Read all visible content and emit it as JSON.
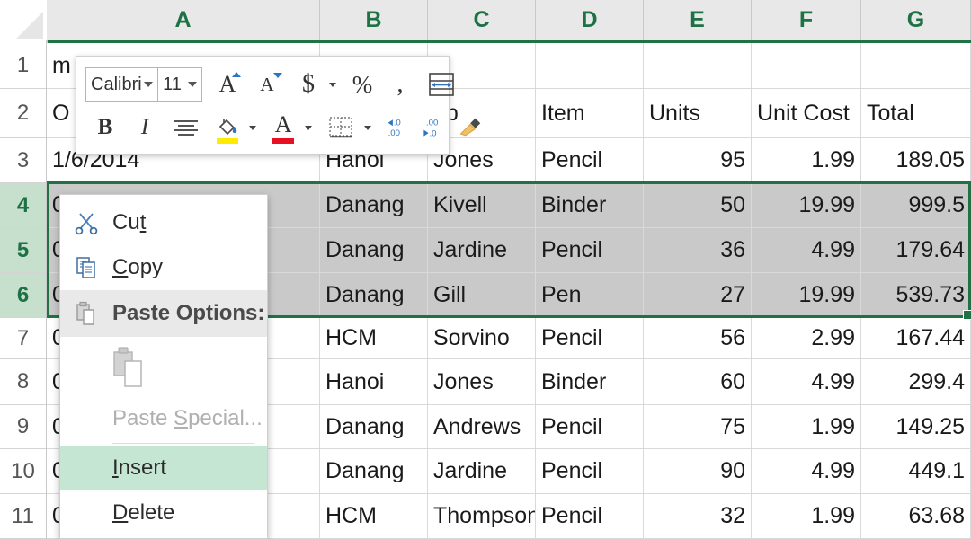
{
  "app": {
    "name": "excel-spreadsheet",
    "accent_green": "#207245",
    "header_text_green": "#1e7145",
    "selection_row_header_bg": "#c6e0cd",
    "selected_cell_bg": "#c9c9c9",
    "menu_highlight_bg": "#c6e6d4"
  },
  "grid": {
    "column_headers": [
      "A",
      "B",
      "C",
      "D",
      "E",
      "F",
      "G"
    ],
    "row_headers": [
      "1",
      "2",
      "3",
      "4",
      "5",
      "6",
      "7",
      "8",
      "9",
      "10",
      "11"
    ],
    "selected_rows": [
      "4",
      "5",
      "6"
    ]
  },
  "sheet": {
    "header_row_index": 2,
    "headers": {
      "A": "",
      "B": "",
      "C": "ep",
      "D": "Item",
      "E": "Units",
      "F": "Unit Cost",
      "G": "Total"
    },
    "partial_cells": {
      "A1": "m",
      "A2": "O"
    },
    "rows": [
      {
        "row": "3",
        "A": "1/6/2014",
        "B": "Hanoi",
        "C": "Jones",
        "D": "Pencil",
        "E": "95",
        "F": "1.99",
        "G": "189.05",
        "selected": false
      },
      {
        "row": "4",
        "A": "014",
        "B": "Danang",
        "C": "Kivell",
        "D": "Binder",
        "E": "50",
        "F": "19.99",
        "G": "999.5",
        "selected": true
      },
      {
        "row": "5",
        "A": "014",
        "B": "Danang",
        "C": "Jardine",
        "D": "Pencil",
        "E": "36",
        "F": "4.99",
        "G": "179.64",
        "selected": true
      },
      {
        "row": "6",
        "A": "014",
        "B": "Danang",
        "C": "Gill",
        "D": "Pen",
        "E": "27",
        "F": "19.99",
        "G": "539.73",
        "selected": true
      },
      {
        "row": "7",
        "A": "014",
        "B": "HCM",
        "C": "Sorvino",
        "D": "Pencil",
        "E": "56",
        "F": "2.99",
        "G": "167.44",
        "selected": false
      },
      {
        "row": "8",
        "A": "014",
        "B": "Hanoi",
        "C": "Jones",
        "D": "Binder",
        "E": "60",
        "F": "4.99",
        "G": "299.4",
        "selected": false
      },
      {
        "row": "9",
        "A": "014",
        "B": "Danang",
        "C": "Andrews",
        "D": "Pencil",
        "E": "75",
        "F": "1.99",
        "G": "149.25",
        "selected": false
      },
      {
        "row": "10",
        "A": "014",
        "B": "Danang",
        "C": "Jardine",
        "D": "Pencil",
        "E": "90",
        "F": "4.99",
        "G": "449.1",
        "selected": false
      },
      {
        "row": "11",
        "A": "014",
        "B": "HCM",
        "C": "Thompson",
        "D": "Pencil",
        "E": "32",
        "F": "1.99",
        "G": "63.68",
        "selected": false
      }
    ]
  },
  "mini_toolbar": {
    "font_name": "Calibri",
    "font_size": "11",
    "buttons": [
      {
        "name": "grow-font-icon",
        "label": "A"
      },
      {
        "name": "shrink-font-icon",
        "label": "A"
      },
      {
        "name": "accounting-number-format-icon",
        "label": "$"
      },
      {
        "name": "percent-style-icon",
        "label": "%"
      },
      {
        "name": "comma-style-icon",
        "label": ","
      },
      {
        "name": "merge-and-center-icon",
        "label": ""
      },
      {
        "name": "bold-icon",
        "label": "B"
      },
      {
        "name": "italic-icon",
        "label": "I"
      },
      {
        "name": "center-align-icon",
        "label": ""
      },
      {
        "name": "fill-color-icon",
        "label": ""
      },
      {
        "name": "font-color-icon",
        "label": "A"
      },
      {
        "name": "borders-icon",
        "label": ""
      },
      {
        "name": "decrease-decimal-icon",
        "label": ""
      },
      {
        "name": "increase-decimal-icon",
        "label": ""
      },
      {
        "name": "format-painter-icon",
        "label": ""
      }
    ],
    "colors": {
      "fill_swatch": "#ffeb00",
      "font_swatch": "#e81123",
      "decimal_arrow": "#2f74c0"
    }
  },
  "context_menu": {
    "items": [
      {
        "name": "cut",
        "label": "Cut",
        "icon": "scissors-icon",
        "state": "normal"
      },
      {
        "name": "copy",
        "label": "Copy",
        "icon": "copy-icon",
        "state": "normal"
      },
      {
        "name": "paste-options",
        "label": "Paste Options:",
        "icon": "paste-icon",
        "state": "header"
      },
      {
        "name": "paste-gallery",
        "label": "",
        "icon": "paste-keep-source-icon",
        "state": "gallery"
      },
      {
        "name": "paste-special",
        "label": "Paste Special...",
        "icon": "",
        "state": "disabled"
      },
      {
        "name": "insert",
        "label": "Insert",
        "icon": "",
        "state": "highlighted"
      },
      {
        "name": "delete",
        "label": "Delete",
        "icon": "",
        "state": "normal"
      }
    ]
  }
}
